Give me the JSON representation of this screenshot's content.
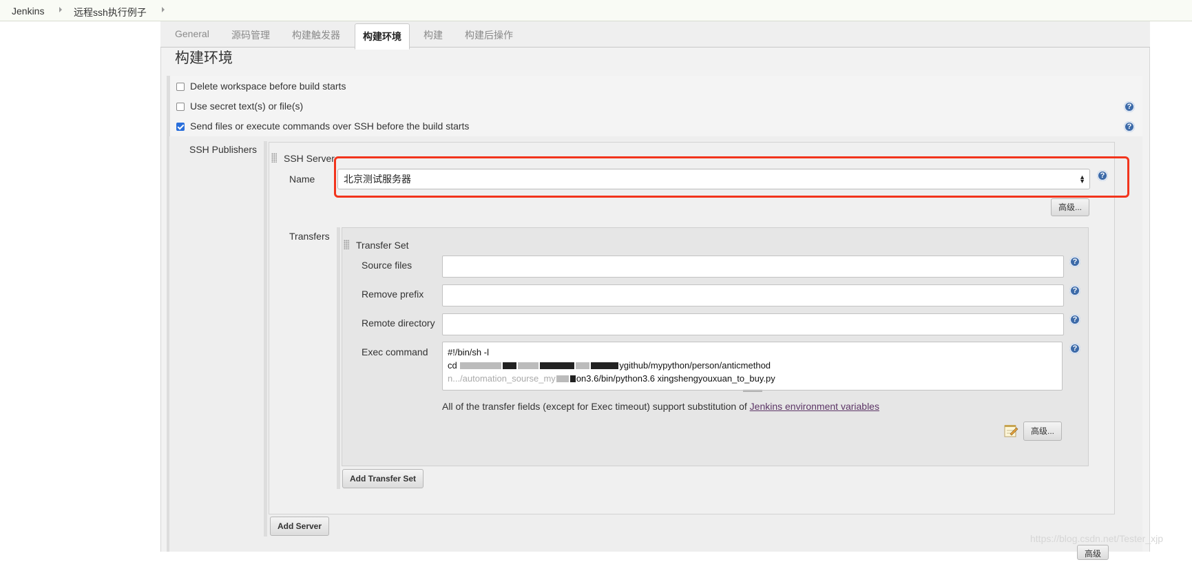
{
  "breadcrumbs": [
    "Jenkins",
    "远程ssh执行例子"
  ],
  "tabs": [
    "General",
    "源码管理",
    "构建触发器",
    "构建环境",
    "构建",
    "构建后操作"
  ],
  "active_tab": "构建环境",
  "section_title": "构建环境",
  "options": [
    {
      "label": "Delete workspace before build starts",
      "checked": false
    },
    {
      "label": "Use secret text(s) or file(s)",
      "checked": false
    },
    {
      "label": "Send files or execute commands over SSH before the build starts",
      "checked": true
    }
  ],
  "ssh": {
    "publishers_label": "SSH Publishers",
    "server_heading": "SSH Server",
    "name_label": "Name",
    "name_value": "北京测试服务器",
    "advanced_label": "高级...",
    "transfers_label": "Transfers",
    "transfer_set_heading": "Transfer Set",
    "source_files_label": "Source files",
    "remove_prefix_label": "Remove prefix",
    "remote_directory_label": "Remote directory",
    "exec_command_label": "Exec command",
    "exec_lines": [
      "#!/bin/sh -l",
      "cd ",
      "ygithub/mypython/person/anticmethod",
      "n.../automation_sourse_my",
      "on3.6/bin/python3.6 xingshengyouxuan_to_buy.py"
    ],
    "note_text": "All of the transfer fields (except for Exec timeout) support substitution of ",
    "note_link": "Jenkins environment variables",
    "transfer_advanced_label": "高级...",
    "add_transfer_set_label": "Add Transfer Set",
    "add_server_label": "Add Server",
    "bottom_advanced_label": "高级"
  },
  "watermark": "https://blog.csdn.net/Tester_xjp",
  "colors": {
    "highlight": "#f2341c",
    "help_icon": "#3c6aa8",
    "checkbox": "#2a6fdb",
    "link": "#5c3566"
  }
}
